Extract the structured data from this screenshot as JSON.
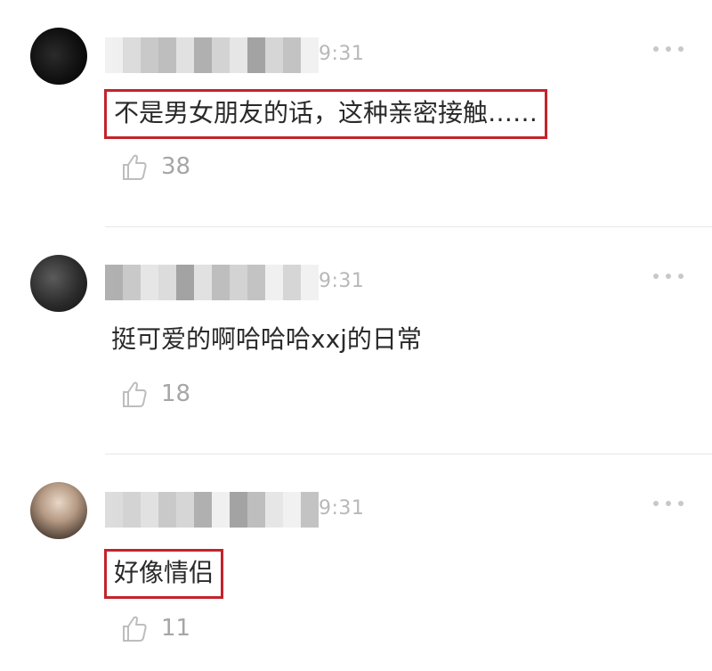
{
  "comments": [
    {
      "time": "9:31",
      "text": "不是男女朋友的话，这种亲密接触……",
      "highlighted": true,
      "likes": "38",
      "avatar": "dark-avatar"
    },
    {
      "time": "9:31",
      "text": "挺可爱的啊哈哈哈xxj的日常",
      "highlighted": false,
      "likes": "18",
      "avatar": "portrait-avatar"
    },
    {
      "time": "9:31",
      "text": "好像情侣",
      "highlighted": true,
      "likes": "11",
      "avatar": "portrait-avatar"
    }
  ],
  "icons": {
    "like": "thumbs-up-icon",
    "more": "more-options-icon"
  },
  "colors": {
    "highlight_border": "#c4232b",
    "meta_text": "#b8b8b8",
    "like_text": "#a6a6a6"
  }
}
